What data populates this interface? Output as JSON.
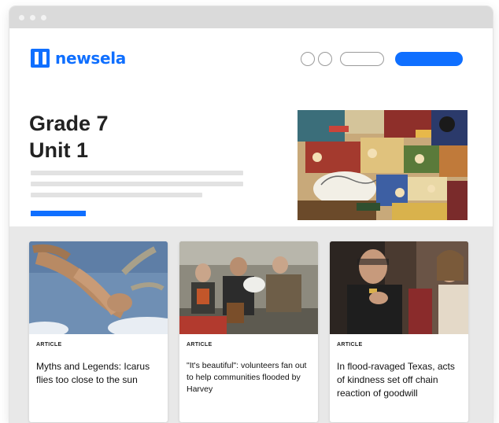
{
  "window": {
    "controls": [
      "close-dot",
      "minimize-dot",
      "maximize-dot"
    ]
  },
  "logo": {
    "text": "newsela",
    "brand_color": "#0f6fff"
  },
  "header": {
    "title_line1": "Grade 7",
    "title_line2": "Unit 1"
  },
  "colors": {
    "accent": "#0f6fff",
    "placeholder_line": "#e2e2e2",
    "cards_bg": "#e8e8e8"
  },
  "cards": [
    {
      "type": "ARTICLE",
      "title": "Myths and Legends: Icarus flies too close to the sun"
    },
    {
      "type": "ARTICLE",
      "title": "\"It's beautiful\": volunteers fan out to help communities flooded by Harvey"
    },
    {
      "type": "ARTICLE",
      "title": "In flood-ravaged Texas, acts of kindness set off chain reaction of goodwill"
    }
  ]
}
